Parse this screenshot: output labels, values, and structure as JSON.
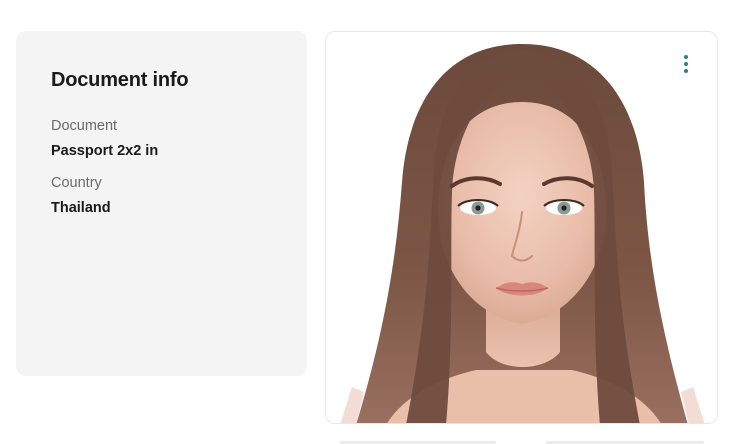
{
  "document_info": {
    "title": "Document info",
    "fields": [
      {
        "label": "Document",
        "value": "Passport 2x2 in"
      },
      {
        "label": "Country",
        "value": "Thailand"
      }
    ]
  },
  "photo_card": {
    "menu_icon": "kebab-vertical-icon",
    "accent_color": "#2f7f86"
  }
}
